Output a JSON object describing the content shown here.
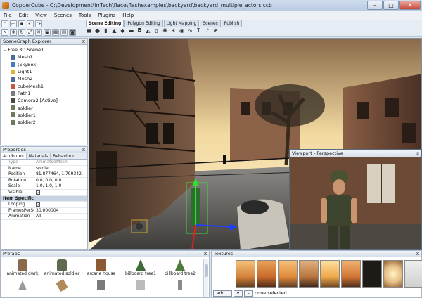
{
  "window": {
    "title": "CopperCube - C:\\Development\\irrTech\\flace\\flashexamples\\backyard\\backyard_multiple_actors.ccb",
    "min": "–",
    "max": "□",
    "close": "✕"
  },
  "menu": [
    "File",
    "Edit",
    "View",
    "Scenes",
    "Tools",
    "Plugins",
    "Help"
  ],
  "tabs": [
    "Scene Editing",
    "Polygon Editing",
    "Light Mapping",
    "Scenes",
    "Publish"
  ],
  "active_tab": "Scene Editing",
  "scenegraph": {
    "title": "SceneGraph Explorer",
    "close": "x",
    "root": "Free 3D Scene1",
    "items": [
      {
        "label": "Mesh1",
        "color": "#4b6d9c"
      },
      {
        "label": "(SkyBox)",
        "color": "#3f7fc0"
      },
      {
        "label": "Light1",
        "color": "#e0b43a"
      },
      {
        "label": "Mesh2",
        "color": "#4b6d9c"
      },
      {
        "label": "cubeMesh1",
        "color": "#c25a3a"
      },
      {
        "label": "Path1",
        "color": "#7a7a7a"
      },
      {
        "label": "Camera2 [Active]",
        "color": "#4a4a4a"
      },
      {
        "label": "soldier",
        "color": "#6a7d5a"
      },
      {
        "label": "soldier1",
        "color": "#6a7d5a"
      },
      {
        "label": "soldier2",
        "color": "#6a7d5a"
      }
    ]
  },
  "properties": {
    "title": "Properties",
    "close": "x",
    "tabs": [
      "Attributes",
      "Materials",
      "Behaviour"
    ],
    "rows": [
      {
        "k": "Type",
        "v": "AnimatedMesh",
        "grey": true
      },
      {
        "k": "Name",
        "v": "soldier"
      },
      {
        "k": "Position",
        "v": "81.877464, 1.799342,"
      },
      {
        "k": "Rotation",
        "v": "0.0, 0.0, 0.0"
      },
      {
        "k": "Scale",
        "v": "1.0, 1.0, 1.0"
      },
      {
        "k": "Visible",
        "v": "✓",
        "check": true
      }
    ],
    "section": "Item Specific",
    "rows2": [
      {
        "k": "Looping",
        "v": "✓",
        "check": true
      },
      {
        "k": "FramesPerSecond",
        "v": "30.000004"
      },
      {
        "k": "Animation",
        "v": "All"
      }
    ]
  },
  "perspective": {
    "title": "Viewport - Perspective",
    "close": "x"
  },
  "prefabs": {
    "title": "Prefabs",
    "close": "x",
    "items": [
      {
        "label": "animated dwrk",
        "color": "#8a6a4a"
      },
      {
        "label": "animated soldier",
        "color": "#5f6b4e"
      },
      {
        "label": "arcane house",
        "color": "#8c5a35"
      },
      {
        "label": "billboard tree1",
        "color": "#3d6b35"
      },
      {
        "label": "billboard tree2",
        "color": "#4f7a3b"
      },
      {
        "label": "",
        "color": "#9a9a9a"
      },
      {
        "label": "",
        "color": "#b08a5a"
      },
      {
        "label": "",
        "color": "#7a7a7a"
      },
      {
        "label": "",
        "color": "#bbbbbb"
      },
      {
        "label": "",
        "color": "#8a8a8a"
      }
    ]
  },
  "textures": {
    "title": "Textures",
    "close": "x",
    "add": "add...",
    "status": "none selected",
    "swatches": [
      "#d4823a",
      "#c96a2a",
      "#e08a3a",
      "#b8753d",
      "#f0a84a",
      "#d07634",
      "#1e1a16",
      "#e7c086",
      "#cfcfcf"
    ]
  }
}
